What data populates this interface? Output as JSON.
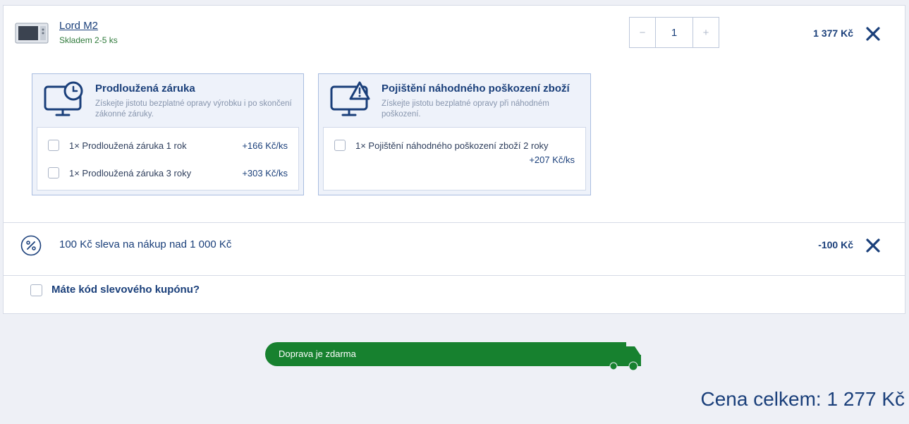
{
  "product": {
    "name": "Lord M2",
    "stock": "Skladem 2-5 ks",
    "quantity": "1",
    "qty_minus": "−",
    "qty_plus": "+",
    "price": "1 377 Kč"
  },
  "services": [
    {
      "title": "Prodloužená záruka",
      "description": "Získejte jistotu bezplatné opravy výrobku i po skončení zákonné záruky.",
      "icon": "monitor-clock-icon",
      "options": [
        {
          "label": "1× Prodloužená záruka 1 rok",
          "price": "+166 Kč/ks"
        },
        {
          "label": "1× Prodloužená záruka 3 roky",
          "price": "+303 Kč/ks"
        }
      ]
    },
    {
      "title": "Pojištění náhodného poškození zboží",
      "description": "Získejte jistotu bezplatné opravy při náhodném poškození.",
      "icon": "monitor-warning-icon",
      "options": [
        {
          "label": "1× Pojištění náhodného poškození zboží 2 roky",
          "price": "+207 Kč/ks"
        }
      ]
    }
  ],
  "discount": {
    "label": "100 Kč sleva na nákup nad 1 000 Kč",
    "amount": "-100 Kč",
    "icon": "percent-icon"
  },
  "coupon": {
    "label": "Máte kód slevového kupónu?"
  },
  "shipping": {
    "label": "Doprava je zdarma",
    "progress": 1.0,
    "color": "#17812f"
  },
  "total": {
    "label": "Cena celkem: 1 277 Kč"
  },
  "colors": {
    "accent": "#1a3f7a",
    "stock": "#2f7a3b",
    "shipping": "#17812f"
  }
}
